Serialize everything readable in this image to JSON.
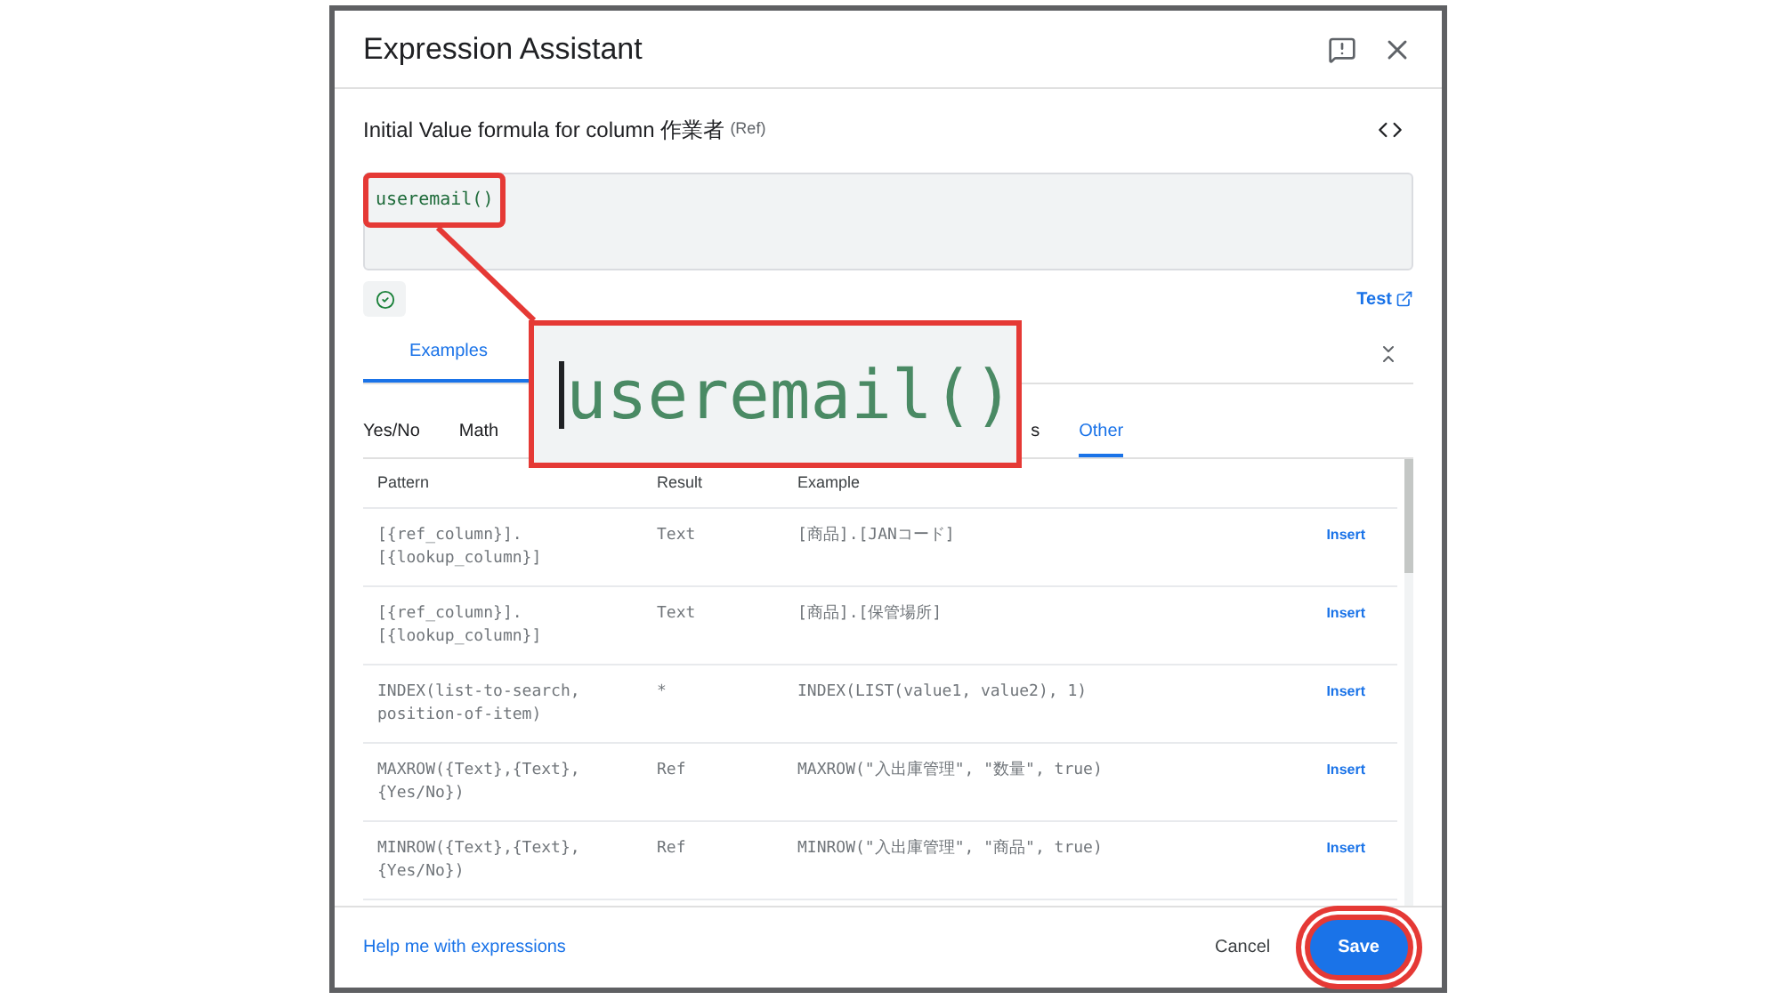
{
  "dialog": {
    "title": "Expression Assistant"
  },
  "formula": {
    "label": "Initial Value formula for column 作業者",
    "type_hint": "(Ref)",
    "value": "useremail()",
    "highlighted": true
  },
  "test_link": "Test",
  "tabs": [
    {
      "label": "Examples",
      "selected": true
    }
  ],
  "categories": [
    {
      "label": "Yes/No",
      "selected": false
    },
    {
      "label": "Math",
      "selected": false
    },
    {
      "label": "s",
      "selected": false
    },
    {
      "label": "Other",
      "selected": true
    }
  ],
  "table": {
    "columns": [
      "Pattern",
      "Result",
      "Example"
    ],
    "rows": [
      {
        "pattern": "[{ref_column}].\n[{lookup_column}]",
        "result": "Text",
        "example": "[商品].[JANコード]",
        "action": "Insert"
      },
      {
        "pattern": "[{ref_column}].\n[{lookup_column}]",
        "result": "Text",
        "example": "[商品].[保管場所]",
        "action": "Insert"
      },
      {
        "pattern": "INDEX(list-to-search,\nposition-of-item)",
        "result": "*",
        "example": "INDEX(LIST(value1, value2), 1)",
        "action": "Insert"
      },
      {
        "pattern": "MAXROW({Text},{Text},\n{Yes/No})",
        "result": "Ref",
        "example": "MAXROW(\"入出庫管理\", \"数量\", true)",
        "action": "Insert"
      },
      {
        "pattern": "MINROW({Text},{Text},\n{Yes/No})",
        "result": "Ref",
        "example": "MINROW(\"入出庫管理\", \"商品\", true)",
        "action": "Insert"
      }
    ]
  },
  "callout": {
    "text": "useremail()"
  },
  "footer": {
    "help_link": "Help me with expressions",
    "buttons": [
      {
        "label": "Cancel",
        "kind": "text",
        "highlighted": false
      },
      {
        "label": "Save",
        "kind": "primary",
        "highlighted": true
      }
    ]
  }
}
